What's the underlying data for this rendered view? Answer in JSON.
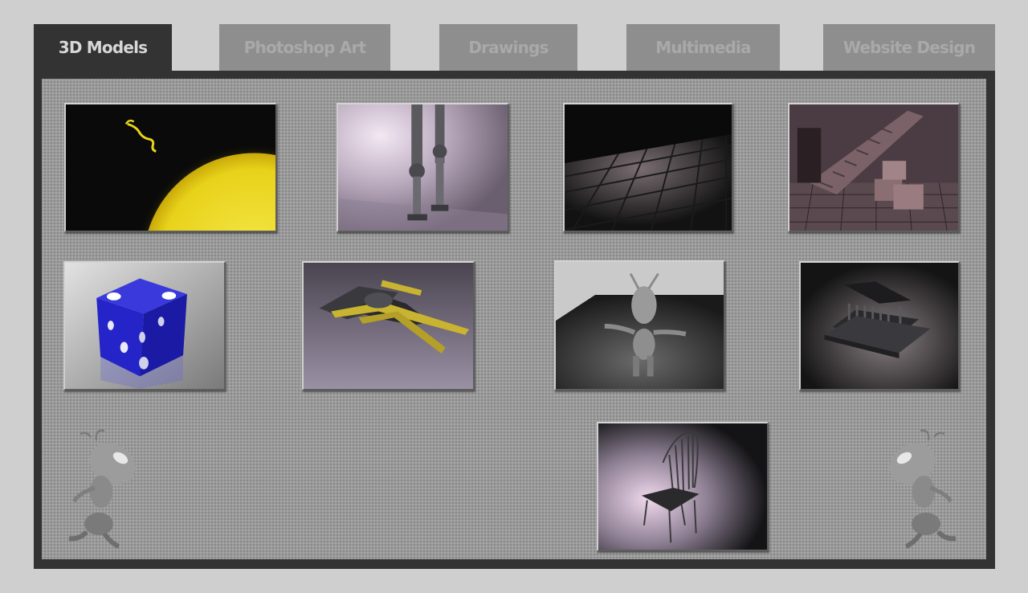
{
  "tabs": [
    {
      "label": "3D Models",
      "active": true
    },
    {
      "label": "Photoshop Art",
      "active": false
    },
    {
      "label": "Drawings",
      "active": false
    },
    {
      "label": "Multimedia",
      "active": false
    },
    {
      "label": "Website Design",
      "active": false
    }
  ],
  "gallery": {
    "rows": [
      [
        "sun-thumbnail",
        "robot-legs-thumbnail",
        "tiled-floor-thumbnail",
        "staircase-room-thumbnail"
      ],
      [
        "dice-thumbnail",
        "starfighter-thumbnail",
        "alien-figure-thumbnail",
        "temple-thumbnail"
      ],
      [
        "chair-thumbnail"
      ]
    ],
    "decorations": [
      "alien-mascot-left",
      "alien-mascot-right"
    ]
  },
  "colors": {
    "page_background": "#cfcfcf",
    "active_tab": "#333333",
    "active_tab_text": "#d8d8d8",
    "inactive_tab": "#8e8e8e",
    "inactive_tab_text": "#a9a9a9",
    "panel_frame": "#333333",
    "panel_fill": "#9a9a9a"
  }
}
